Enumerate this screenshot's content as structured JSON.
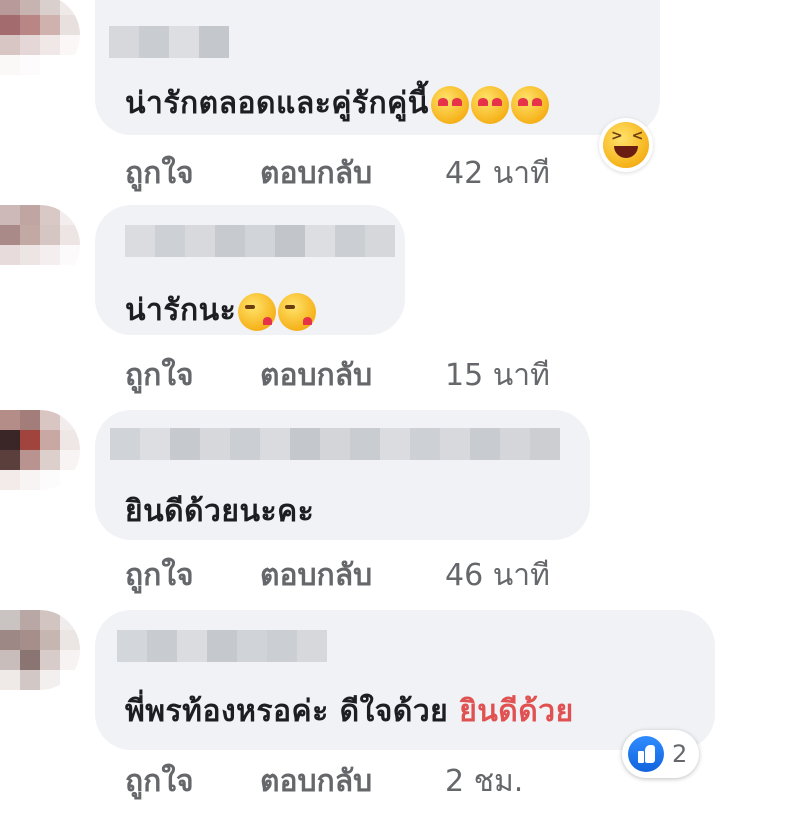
{
  "comments": [
    {
      "text": "น่ารักตลอดและคู่รักคู่นี้",
      "emoji_count": 3,
      "like_label": "ถูกใจ",
      "reply_label": "ตอบกลับ",
      "time": "42 นาที",
      "reaction_emoji": "laughing-reaction-icon"
    },
    {
      "text": "น่ารักนะ",
      "emoji_count": 2,
      "like_label": "ถูกใจ",
      "reply_label": "ตอบกลับ",
      "time": "15 นาที"
    },
    {
      "text": "ยินดีด้วยนะคะ",
      "like_label": "ถูกใจ",
      "reply_label": "ตอบกลับ",
      "time": "46 นาที"
    },
    {
      "text": "พี่พรท้องหรอค่ะ ดีใจด้วย",
      "text_highlight": "ยินดีด้วย",
      "highlight_color": "#e05252",
      "like_label": "ถูกใจ",
      "reply_label": "ตอบกลับ",
      "time": "2 ชม.",
      "reaction_count": "2",
      "reaction_icon": "like-icon"
    }
  ],
  "colors": {
    "bubble": "#f0f2f5",
    "action_text": "#65676b",
    "comment_text": "#1c1e21",
    "like_blue": "#1877f2"
  }
}
